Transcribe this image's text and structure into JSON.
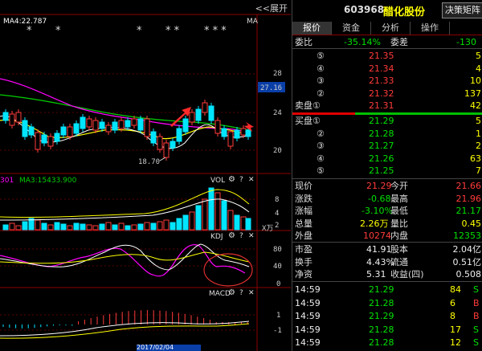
{
  "chart": {
    "expand_label": "<<展开",
    "ma_main_label": "MA4:22.787",
    "ma_right_label": "MA",
    "price_ticks": [
      "28",
      "24",
      "20"
    ],
    "current_price_tag": "27.16",
    "low_marker": "18.70",
    "vol_ma_label": "MA3:15433.900",
    "vol_left_fragment": "301",
    "vol_title": "VOL",
    "vol_ticks": [
      "8",
      "4",
      "2"
    ],
    "vol_unit": "X万",
    "kdj_title": "KDJ",
    "kdj_ticks": [
      "80",
      "40",
      "0"
    ],
    "macd_title": "MACD",
    "macd_ticks": [
      "1",
      "-1"
    ],
    "star_marks": [
      "*",
      "*",
      "*",
      "* *",
      "* * *"
    ],
    "bottom_date_fragment": "2017/02/04",
    "colors": {
      "up": "#ff3b3b",
      "down": "#00e5ff",
      "ma_white": "#ffffff",
      "ma_yellow": "#ffff00",
      "ma_magenta": "#ff00ff",
      "ma_green": "#00d000"
    }
  },
  "panel": {
    "code": "603968",
    "name": "醋化股份",
    "decision_button": "决策矩阵",
    "tabs": [
      "报价",
      "资金",
      "分析",
      "操作"
    ],
    "weibi_label": "委比",
    "weibi_value": "-35.14%",
    "weicha_label": "委差",
    "weicha_value": "-130",
    "asks": [
      {
        "num": "⑤",
        "price": "21.35",
        "vol": "5"
      },
      {
        "num": "④",
        "price": "21.34",
        "vol": "4"
      },
      {
        "num": "③",
        "price": "21.33",
        "vol": "10"
      },
      {
        "num": "②",
        "price": "21.32",
        "vol": "137"
      },
      {
        "num": "卖盘①",
        "price": "21.31",
        "vol": "42"
      }
    ],
    "bids": [
      {
        "num": "买盘①",
        "price": "21.29",
        "vol": "5"
      },
      {
        "num": "②",
        "price": "21.28",
        "vol": "1"
      },
      {
        "num": "③",
        "price": "21.27",
        "vol": "2"
      },
      {
        "num": "④",
        "price": "21.26",
        "vol": "63"
      },
      {
        "num": "⑤",
        "price": "21.25",
        "vol": "7"
      }
    ],
    "stats": [
      {
        "l1": "现价",
        "v1": "21.29",
        "l2": "今开",
        "v2": "21.66"
      },
      {
        "l1": "涨跌",
        "v1": "-0.68",
        "l2": "最高",
        "v2": "21.96"
      },
      {
        "l1": "涨幅",
        "v1": "-3.10%",
        "l2": "最低",
        "v2": "21.17"
      },
      {
        "l1": "总量",
        "v1": "2.26万",
        "l2": "量比",
        "v2": "0.45"
      },
      {
        "l1": "外盘",
        "v1": "10274",
        "l2": "内盘",
        "v2": "12353"
      }
    ],
    "stats2": [
      {
        "l1": "市盈",
        "v1": "41.91",
        "l2": "股本",
        "v2": "2.04亿"
      },
      {
        "l1": "换手",
        "v1": "4.43%",
        "l2": "流通",
        "v2": "0.51亿"
      },
      {
        "l1": "净资",
        "v1": "5.31",
        "l2": "收益(四)",
        "v2": "0.508"
      }
    ],
    "trades": [
      {
        "time": "14:59",
        "price": "21.29",
        "vol": "84",
        "side": "S"
      },
      {
        "time": "14:59",
        "price": "21.28",
        "vol": "6",
        "side": "B"
      },
      {
        "time": "14:59",
        "price": "21.29",
        "vol": "8",
        "side": "B"
      },
      {
        "time": "14:59",
        "price": "21.28",
        "vol": "17",
        "side": "S"
      },
      {
        "time": "14:59",
        "price": "21.28",
        "vol": "12",
        "side": "S"
      }
    ]
  }
}
